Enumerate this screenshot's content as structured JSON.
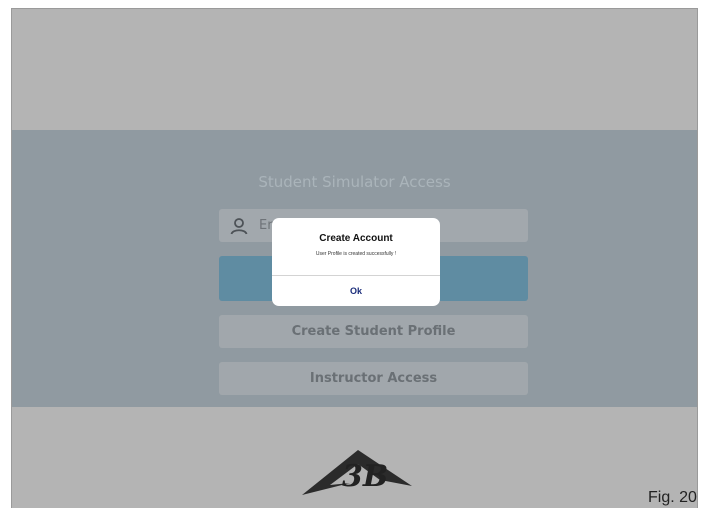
{
  "access_screen": {
    "title": "Student Simulator Access",
    "id_input_placeholder": "Er",
    "create_profile_label": "Create Student Profile",
    "instructor_label": "Instructor Access"
  },
  "dialog": {
    "title": "Create Account",
    "message": "User Profile is created successfully !",
    "ok_label": "Ok"
  },
  "logo": {
    "text": "3B"
  },
  "caption": "Fig. 20",
  "colors": {
    "panel": "#909aa1",
    "band": "#b4b4b4",
    "login_button": "#5f8ca2",
    "dialog_ok": "#1a2c7a"
  },
  "icons": [
    "user-icon",
    "3b-logo"
  ]
}
